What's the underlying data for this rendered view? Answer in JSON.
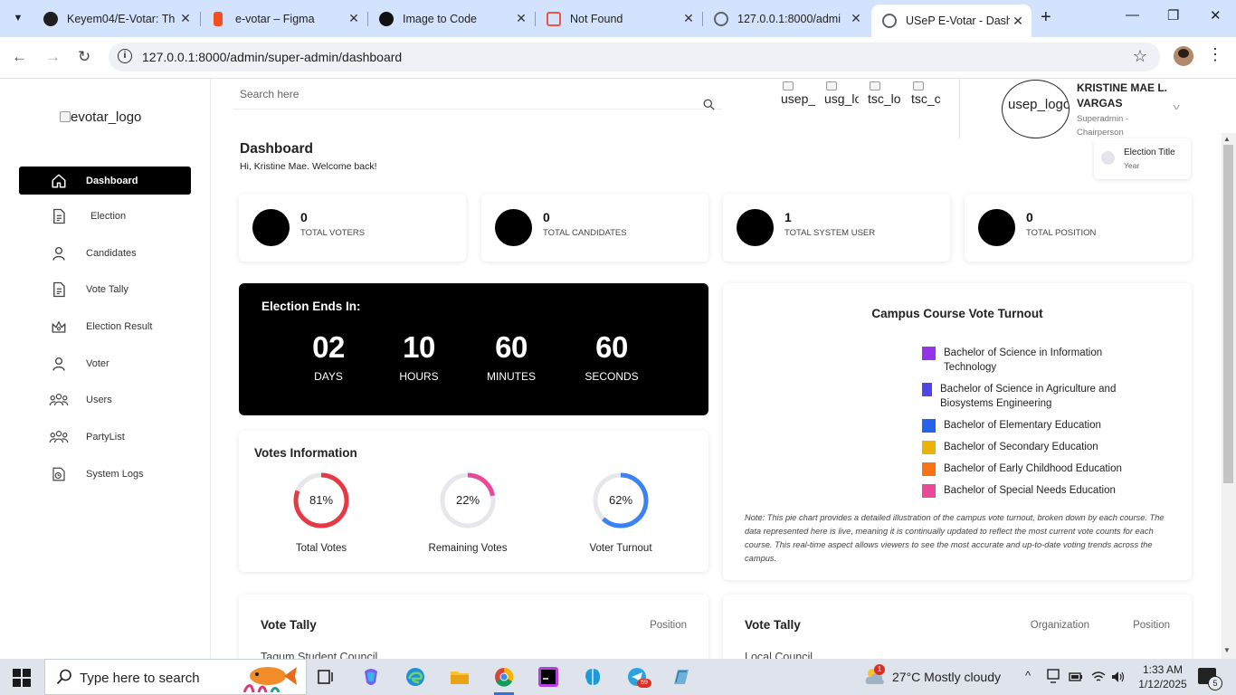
{
  "browser": {
    "tabs": [
      {
        "title": "Keyem04/E-Votar: Th",
        "favicon_color": "#1f1f1f"
      },
      {
        "title": "e-votar – Figma",
        "favicon_color": "#f24e1e"
      },
      {
        "title": "Image to Code",
        "favicon_color": "#111111"
      },
      {
        "title": "Not Found",
        "favicon_color": "#f05340"
      },
      {
        "title": "127.0.0.1:8000/admi",
        "favicon_color": "#5f6368"
      },
      {
        "title": "USeP E-Votar - Dashb",
        "favicon_color": "#5f6368"
      }
    ],
    "url": "127.0.0.1:8000/admin/super-admin/dashboard"
  },
  "sidebar": {
    "logo_alt": "evotar_logo",
    "items": [
      {
        "label": "Dashboard",
        "icon": "home-icon",
        "active": true
      },
      {
        "label": "Election",
        "icon": "document-icon"
      },
      {
        "label": "Candidates",
        "icon": "person-icon"
      },
      {
        "label": "Vote Tally",
        "icon": "document-icon"
      },
      {
        "label": "Election Result",
        "icon": "crown-icon"
      },
      {
        "label": "Voter",
        "icon": "person-icon"
      },
      {
        "label": "Users",
        "icon": "users-icon"
      },
      {
        "label": "PartyList",
        "icon": "users-icon"
      },
      {
        "label": "System Logs",
        "icon": "logs-icon"
      }
    ]
  },
  "header": {
    "search_placeholder": "Search here",
    "org_logos": [
      "usep_",
      "usg_lo",
      "tsc_lo",
      "tsc_c"
    ],
    "usep_logo_alt": "usep_logo",
    "user_name": "KRISTINE MAE L. VARGAS",
    "user_role": "Superadmin - Chairperson",
    "election_title": "Election Title",
    "election_year": "Year"
  },
  "dashboard": {
    "title": "Dashboard",
    "welcome": "Hi, Kristine Mae. Welcome back!",
    "stats": [
      {
        "value": "0",
        "label": "TOTAL VOTERS"
      },
      {
        "value": "0",
        "label": "TOTAL CANDIDATES"
      },
      {
        "value": "1",
        "label": "TOTAL SYSTEM USER"
      },
      {
        "value": "0",
        "label": "TOTAL POSITION"
      }
    ]
  },
  "countdown": {
    "title": "Election Ends In:",
    "units": [
      {
        "value": "02",
        "label": "DAYS"
      },
      {
        "value": "10",
        "label": "HOURS"
      },
      {
        "value": "60",
        "label": "MINUTES"
      },
      {
        "value": "60",
        "label": "SECONDS"
      }
    ]
  },
  "votes_info": {
    "title": "Votes Information",
    "rings": [
      {
        "label": "Total Votes",
        "percent_text": "81%",
        "fraction": 0.81,
        "color": "#e63946"
      },
      {
        "label": "Remaining Votes",
        "percent_text": "22%",
        "fraction": 0.22,
        "color": "#ec4899"
      },
      {
        "label": "Voter Turnout",
        "percent_text": "62%",
        "fraction": 0.62,
        "color": "#3b82f6"
      }
    ],
    "track_color": "#e5e7eb"
  },
  "campus_chart": {
    "title": "Campus Course Vote Turnout",
    "legend": [
      {
        "label": "Bachelor of Science in Information Technology",
        "color": "#9333ea"
      },
      {
        "label": "Bachelor of Science in Agriculture and Biosystems Engineering",
        "color": "#4f46e5"
      },
      {
        "label": "Bachelor of Elementary Education",
        "color": "#2563eb"
      },
      {
        "label": "Bachelor of Secondary Education",
        "color": "#eab308"
      },
      {
        "label": "Bachelor of Early Childhood Education",
        "color": "#f97316"
      },
      {
        "label": "Bachelor of Special Needs Education",
        "color": "#ec4899"
      }
    ],
    "note": "Note: This pie chart provides a detailed illustration of the campus vote turnout, broken down by each course. The data represented here is live, meaning it is continually updated to reflect the most current vote counts for each course. This real-time aspect allows viewers to see the most accurate and up-to-date voting trends across the campus."
  },
  "vote_tally_left": {
    "title": "Vote Tally",
    "filter": "Position",
    "subtitle": "Tagum Student Council"
  },
  "vote_tally_right": {
    "title": "Vote Tally",
    "filter_org": "Organization",
    "filter_pos": "Position",
    "subtitle": "Local Council"
  },
  "taskbar": {
    "search_placeholder": "Type here to search",
    "weather": "27°C  Mostly cloudy",
    "weather_badge": "1",
    "time": "1:33 AM",
    "date": "1/12/2025",
    "notification_count": "5",
    "telegram_badge": "59"
  }
}
